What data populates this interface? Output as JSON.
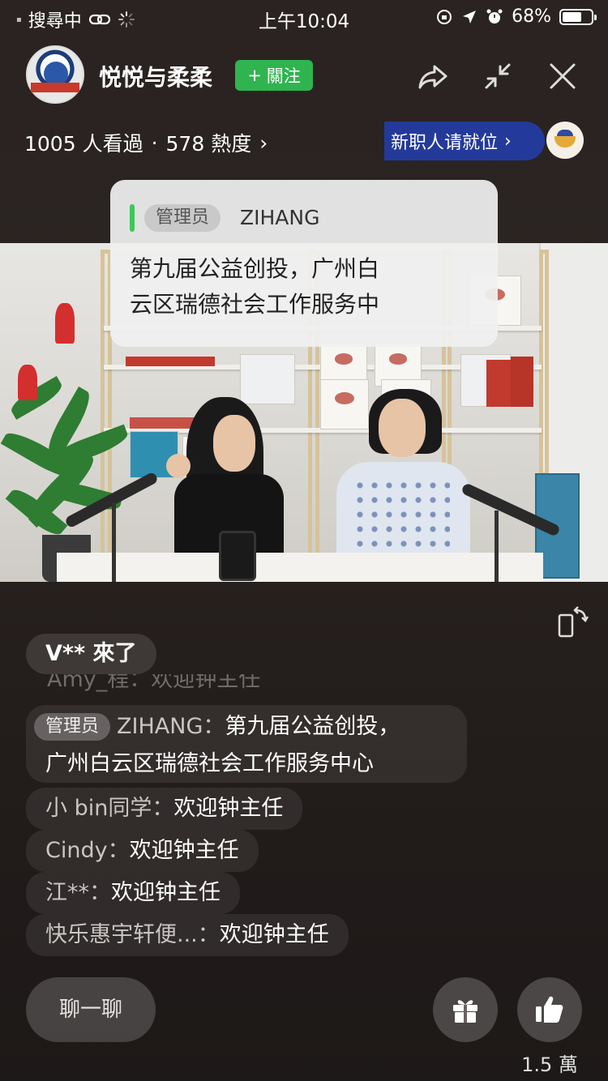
{
  "status_bar": {
    "carrier": "搜尋中",
    "time": "上午10:04",
    "battery_percent": "68%",
    "battery_level": 0.68
  },
  "header": {
    "host_name": "悦悦与柔柔",
    "follow_label": "關注",
    "viewers": "1005 人看過",
    "heat": "578 熱度",
    "promo_label": "新职人请就位"
  },
  "pinned": {
    "role": "管理员",
    "user": "ZIHANG",
    "message_line1": "第九届公益创投，广州白",
    "message_line2": "云区瑞德社会工作服务中"
  },
  "chat": {
    "joined": "V** 來了",
    "faded": "Amy_程：欢迎钟主任",
    "admin": {
      "role": "管理员",
      "user": "ZIHANG：",
      "text_line1": "第九届公益创投，",
      "text_line2": "广州白云区瑞德社会工作服务中心"
    },
    "messages": [
      {
        "user": "小 bin同学：",
        "text": "欢迎钟主任"
      },
      {
        "user": "Cindy：",
        "text": "欢迎钟主任"
      },
      {
        "user": "江**：",
        "text": "欢迎钟主任"
      },
      {
        "user": "快乐惠宇轩便...：",
        "text": "欢迎钟主任"
      }
    ]
  },
  "bottom": {
    "chat_placeholder": "聊一聊",
    "like_count": "1.5 萬"
  },
  "colors": {
    "follow_green": "#2fb44f",
    "promo_blue": "#243a9a",
    "pinned_bar": "#3cc85a"
  }
}
